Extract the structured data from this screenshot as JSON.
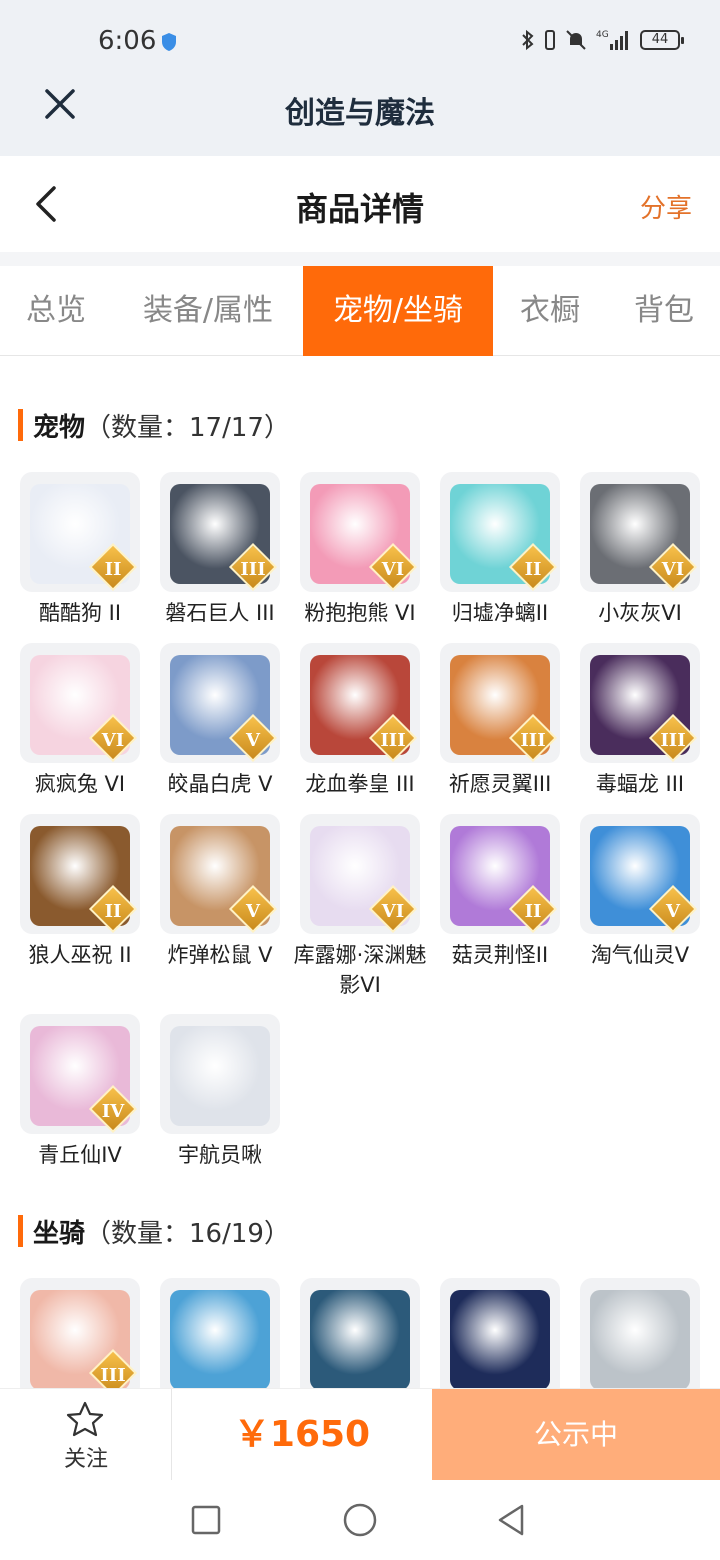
{
  "status_bar": {
    "time": "6:06",
    "battery": "44"
  },
  "app_bar": {
    "title": "创造与魔法"
  },
  "header": {
    "title": "商品详情",
    "share": "分享"
  },
  "tabs": [
    {
      "label": "总览",
      "active": false
    },
    {
      "label": "装备/属性",
      "active": false
    },
    {
      "label": "宠物/坐骑",
      "active": true
    },
    {
      "label": "衣橱",
      "active": false
    },
    {
      "label": "背包",
      "active": false
    }
  ],
  "pets": {
    "title": "宠物",
    "count": "（数量：17/17）",
    "items": [
      {
        "name": "酷酷狗 II",
        "rank": "II",
        "color": "#e9edf5"
      },
      {
        "name": "磐石巨人 III",
        "rank": "III",
        "color": "#4b5462"
      },
      {
        "name": "粉抱抱熊 VI",
        "rank": "VI",
        "color": "#f39bb7"
      },
      {
        "name": "归墟净螭II",
        "rank": "II",
        "color": "#6fd3d6"
      },
      {
        "name": "小灰灰VI",
        "rank": "VI",
        "color": "#6b6e74"
      },
      {
        "name": "疯疯兔 VI",
        "rank": "VI",
        "color": "#f6d4e0"
      },
      {
        "name": "皎晶白虎 V",
        "rank": "V",
        "color": "#7d9bc9"
      },
      {
        "name": "龙血拳皇 III",
        "rank": "III",
        "color": "#b9473a"
      },
      {
        "name": "祈愿灵翼III",
        "rank": "III",
        "color": "#d9823f"
      },
      {
        "name": "毒蝠龙 III",
        "rank": "III",
        "color": "#4a2d5c"
      },
      {
        "name": "狼人巫祝 II",
        "rank": "II",
        "color": "#8a5a2e"
      },
      {
        "name": "炸弹松鼠 V",
        "rank": "V",
        "color": "#c79466"
      },
      {
        "name": "库露娜·深渊魅影VI",
        "rank": "VI",
        "color": "#e7dcf0"
      },
      {
        "name": "菇灵荆怪II",
        "rank": "II",
        "color": "#b07ad8"
      },
      {
        "name": "淘气仙灵V",
        "rank": "V",
        "color": "#3f8fd8"
      },
      {
        "name": "青丘仙IV",
        "rank": "IV",
        "color": "#e9b9d8"
      },
      {
        "name": "宇航员啾",
        "rank": "",
        "color": "#dfe3ea"
      }
    ]
  },
  "mounts": {
    "title": "坐骑",
    "count": "（数量：16/19）",
    "items": [
      {
        "name": "",
        "rank": "III",
        "color": "#f0b8a8"
      },
      {
        "name": "",
        "rank": "",
        "color": "#4da2d6"
      },
      {
        "name": "",
        "rank": "",
        "color": "#2c5a7a"
      },
      {
        "name": "",
        "rank": "",
        "color": "#1e2c5a"
      },
      {
        "name": "",
        "rank": "",
        "color": "#bcc3c9"
      }
    ]
  },
  "bottom": {
    "follow": "关注",
    "price": "￥1650",
    "status": "公示中"
  }
}
